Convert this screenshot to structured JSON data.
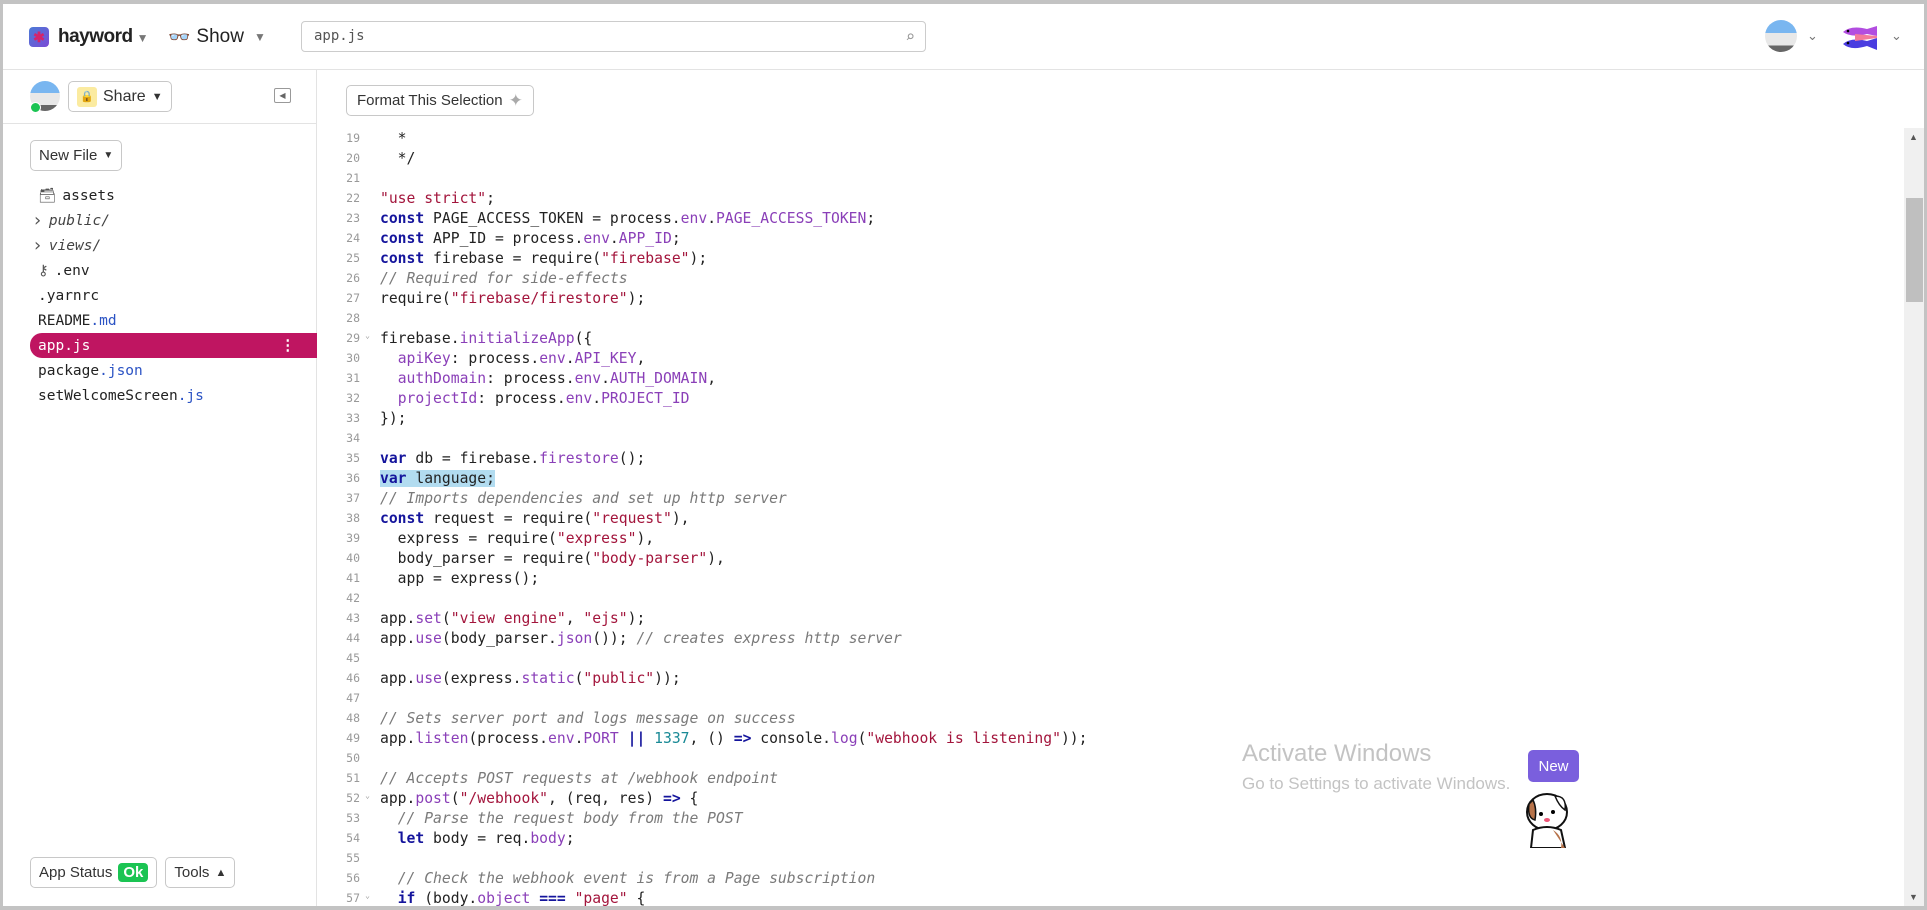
{
  "header": {
    "project": "hayword",
    "show_label": "Show",
    "search_value": "app.js"
  },
  "sidebar": {
    "share_label": "Share",
    "new_file_label": "New File",
    "files": [
      {
        "name": "assets",
        "ext": "",
        "icon": "archive-icon",
        "kind": "folder"
      },
      {
        "name": "public/",
        "ext": "",
        "icon": "chevron-right-icon",
        "kind": "dir"
      },
      {
        "name": "views/",
        "ext": "",
        "icon": "chevron-right-icon",
        "kind": "dir"
      },
      {
        "name": ".env",
        "ext": "",
        "icon": "key-icon",
        "kind": "file"
      },
      {
        "name": ".yarnrc",
        "ext": "",
        "kind": "file"
      },
      {
        "name": "README",
        "ext": ".md",
        "kind": "file"
      },
      {
        "name": "app",
        "ext": ".js",
        "kind": "file",
        "selected": true
      },
      {
        "name": "package",
        "ext": ".json",
        "kind": "file"
      },
      {
        "name": "setWelcomeScreen",
        "ext": ".js",
        "kind": "file"
      }
    ],
    "app_status_label": "App Status",
    "app_status_value": "Ok",
    "tools_label": "Tools"
  },
  "editor": {
    "format_label": "Format This Selection",
    "highlight_line": 36,
    "lines": [
      {
        "n": 19,
        "t": [
          [
            "",
            "  *"
          ]
        ]
      },
      {
        "n": 20,
        "t": [
          [
            "",
            "  */"
          ]
        ]
      },
      {
        "n": 21,
        "t": []
      },
      {
        "n": 22,
        "t": [
          [
            "s",
            "\"use strict\""
          ],
          [
            "",
            ";"
          ]
        ]
      },
      {
        "n": 23,
        "t": [
          [
            "k",
            "const"
          ],
          [
            "",
            " PAGE_ACCESS_TOKEN = process."
          ],
          [
            "p",
            "env"
          ],
          [
            "",
            "."
          ],
          [
            "p",
            "PAGE_ACCESS_TOKEN"
          ],
          [
            "",
            ";"
          ]
        ]
      },
      {
        "n": 24,
        "t": [
          [
            "k",
            "const"
          ],
          [
            "",
            " APP_ID = process."
          ],
          [
            "p",
            "env"
          ],
          [
            "",
            "."
          ],
          [
            "p",
            "APP_ID"
          ],
          [
            "",
            ";"
          ]
        ]
      },
      {
        "n": 25,
        "t": [
          [
            "k",
            "const"
          ],
          [
            "",
            " firebase = require("
          ],
          [
            "s",
            "\"firebase\""
          ],
          [
            "",
            ");"
          ]
        ]
      },
      {
        "n": 26,
        "t": [
          [
            "c",
            "// Required for side-effects"
          ]
        ]
      },
      {
        "n": 27,
        "t": [
          [
            "",
            "require("
          ],
          [
            "s",
            "\"firebase/firestore\""
          ],
          [
            "",
            ");"
          ]
        ]
      },
      {
        "n": 28,
        "t": []
      },
      {
        "n": 29,
        "fold": true,
        "t": [
          [
            "",
            "firebase."
          ],
          [
            "p",
            "initializeApp"
          ],
          [
            "",
            "({"
          ]
        ]
      },
      {
        "n": 30,
        "t": [
          [
            "",
            "  "
          ],
          [
            "p",
            "apiKey"
          ],
          [
            "",
            ": process."
          ],
          [
            "p",
            "env"
          ],
          [
            "",
            "."
          ],
          [
            "p",
            "API_KEY"
          ],
          [
            "",
            ","
          ]
        ]
      },
      {
        "n": 31,
        "t": [
          [
            "",
            "  "
          ],
          [
            "p",
            "authDomain"
          ],
          [
            "",
            ": process."
          ],
          [
            "p",
            "env"
          ],
          [
            "",
            "."
          ],
          [
            "p",
            "AUTH_DOMAIN"
          ],
          [
            "",
            ","
          ]
        ]
      },
      {
        "n": 32,
        "t": [
          [
            "",
            "  "
          ],
          [
            "p",
            "projectId"
          ],
          [
            "",
            ": process."
          ],
          [
            "p",
            "env"
          ],
          [
            "",
            "."
          ],
          [
            "p",
            "PROJECT_ID"
          ]
        ]
      },
      {
        "n": 33,
        "t": [
          [
            "",
            "});"
          ]
        ]
      },
      {
        "n": 34,
        "t": []
      },
      {
        "n": 35,
        "t": [
          [
            "k",
            "var"
          ],
          [
            "",
            " db = firebase."
          ],
          [
            "p",
            "firestore"
          ],
          [
            "",
            "();"
          ]
        ]
      },
      {
        "n": 36,
        "t": [
          [
            "k",
            "var"
          ],
          [
            "",
            " language;"
          ]
        ]
      },
      {
        "n": 37,
        "t": [
          [
            "c",
            "// Imports dependencies and set up http server"
          ]
        ]
      },
      {
        "n": 38,
        "t": [
          [
            "k",
            "const"
          ],
          [
            "",
            " request = require("
          ],
          [
            "s",
            "\"request\""
          ],
          [
            "",
            "),"
          ]
        ]
      },
      {
        "n": 39,
        "t": [
          [
            "",
            "  express = require("
          ],
          [
            "s",
            "\"express\""
          ],
          [
            "",
            "),"
          ]
        ]
      },
      {
        "n": 40,
        "t": [
          [
            "",
            "  body_parser = require("
          ],
          [
            "s",
            "\"body-parser\""
          ],
          [
            "",
            "),"
          ]
        ]
      },
      {
        "n": 41,
        "t": [
          [
            "",
            "  app = express();"
          ]
        ]
      },
      {
        "n": 42,
        "t": []
      },
      {
        "n": 43,
        "t": [
          [
            "",
            "app."
          ],
          [
            "p",
            "set"
          ],
          [
            "",
            "("
          ],
          [
            "s",
            "\"view engine\""
          ],
          [
            "",
            ", "
          ],
          [
            "s",
            "\"ejs\""
          ],
          [
            "",
            ");"
          ]
        ]
      },
      {
        "n": 44,
        "t": [
          [
            "",
            "app."
          ],
          [
            "p",
            "use"
          ],
          [
            "",
            "(body_parser."
          ],
          [
            "p",
            "json"
          ],
          [
            "",
            "()); "
          ],
          [
            "c",
            "// creates express http server"
          ]
        ]
      },
      {
        "n": 45,
        "t": []
      },
      {
        "n": 46,
        "t": [
          [
            "",
            "app."
          ],
          [
            "p",
            "use"
          ],
          [
            "",
            "(express."
          ],
          [
            "p",
            "static"
          ],
          [
            "",
            "("
          ],
          [
            "s",
            "\"public\""
          ],
          [
            "",
            "));"
          ]
        ]
      },
      {
        "n": 47,
        "t": []
      },
      {
        "n": 48,
        "t": [
          [
            "c",
            "// Sets server port and logs message on success"
          ]
        ]
      },
      {
        "n": 49,
        "t": [
          [
            "",
            "app."
          ],
          [
            "p",
            "listen"
          ],
          [
            "",
            "(process."
          ],
          [
            "p",
            "env"
          ],
          [
            "",
            "."
          ],
          [
            "p",
            "PORT"
          ],
          [
            "",
            " "
          ],
          [
            "k",
            "||"
          ],
          [
            "",
            " "
          ],
          [
            "n",
            "1337"
          ],
          [
            "",
            ", () "
          ],
          [
            "k",
            "=>"
          ],
          [
            "",
            " console."
          ],
          [
            "p",
            "log"
          ],
          [
            "",
            "("
          ],
          [
            "s",
            "\"webhook is listening\""
          ],
          [
            "",
            "));"
          ]
        ]
      },
      {
        "n": 50,
        "t": []
      },
      {
        "n": 51,
        "t": [
          [
            "c",
            "// Accepts POST requests at /webhook endpoint"
          ]
        ]
      },
      {
        "n": 52,
        "fold": true,
        "t": [
          [
            "",
            "app."
          ],
          [
            "p",
            "post"
          ],
          [
            "",
            "("
          ],
          [
            "s",
            "\"/webhook\""
          ],
          [
            "",
            ", (req, res) "
          ],
          [
            "k",
            "=>"
          ],
          [
            "",
            " {"
          ]
        ]
      },
      {
        "n": 53,
        "t": [
          [
            "",
            "  "
          ],
          [
            "c",
            "// Parse the request body from the POST"
          ]
        ]
      },
      {
        "n": 54,
        "t": [
          [
            "",
            "  "
          ],
          [
            "k",
            "let"
          ],
          [
            "",
            " body = req."
          ],
          [
            "p",
            "body"
          ],
          [
            "",
            ";"
          ]
        ]
      },
      {
        "n": 55,
        "t": []
      },
      {
        "n": 56,
        "t": [
          [
            "",
            "  "
          ],
          [
            "c",
            "// Check the webhook event is from a Page subscription"
          ]
        ]
      },
      {
        "n": 57,
        "fold": true,
        "t": [
          [
            "",
            "  "
          ],
          [
            "k",
            "if"
          ],
          [
            "",
            " (body."
          ],
          [
            "p",
            "object"
          ],
          [
            "",
            " "
          ],
          [
            "k",
            "==="
          ],
          [
            "",
            " "
          ],
          [
            "s",
            "\"page\""
          ],
          [
            "",
            " {"
          ]
        ]
      }
    ]
  },
  "watermark": {
    "title": "Activate Windows",
    "subtitle": "Go to Settings to activate Windows."
  },
  "new_badge": "New",
  "colors": {
    "selected": "#bf1561",
    "ok": "#1bc453",
    "badge": "#7a5fdd",
    "highlight": "#b2dcf0"
  }
}
